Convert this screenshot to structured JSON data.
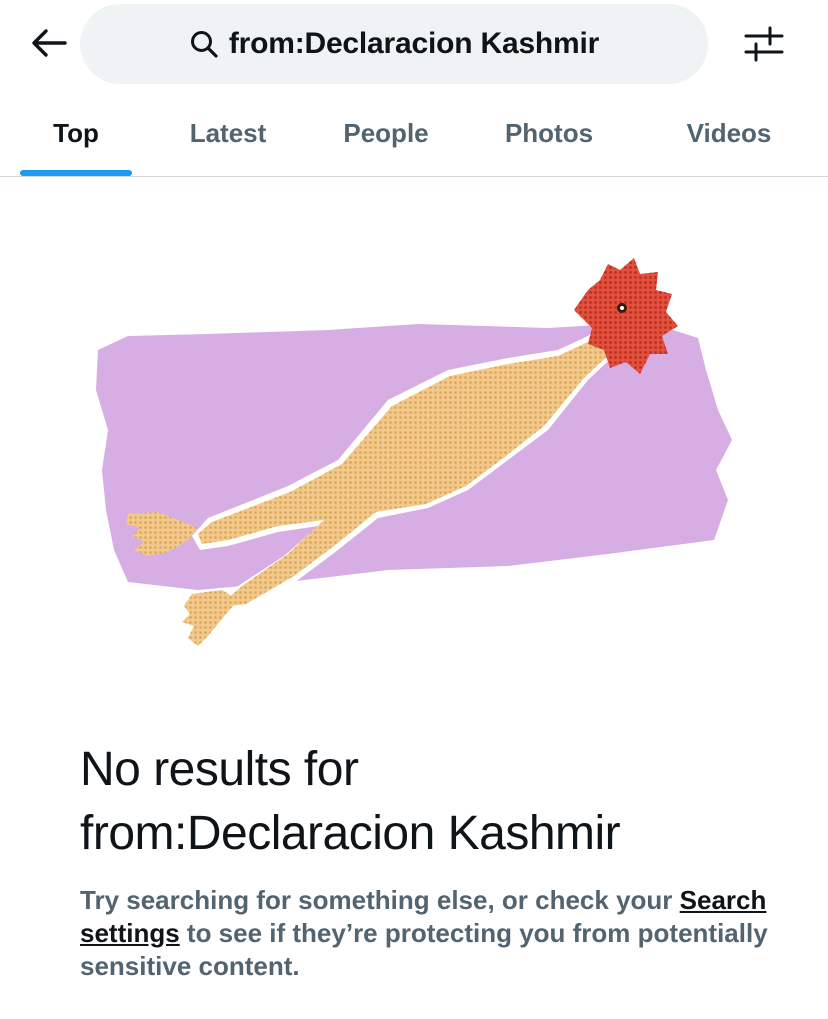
{
  "header": {
    "back_icon": "arrow-left-icon",
    "search_icon": "search-icon",
    "search_query": "from:Declaracion Kashmir",
    "filter_icon": "sliders-icon"
  },
  "tabs": [
    {
      "label": "Top",
      "active": true
    },
    {
      "label": "Latest",
      "active": false
    },
    {
      "label": "People",
      "active": false
    },
    {
      "label": "Photos",
      "active": false
    },
    {
      "label": "Videos",
      "active": false
    }
  ],
  "colors": {
    "accent": "#1d9bf0",
    "muted_text": "#536471",
    "search_bg": "#eff3f4",
    "illustration_bg": "#d7aee3"
  },
  "empty_state": {
    "illustration": "rubber-chicken-illustration",
    "title_line1": "No results for",
    "title_line2": "from:Declaracion Kashmir",
    "body_prefix": "Try searching for something else, or check your",
    "link_text": "Search settings",
    "body_suffix": " to see if they’re protecting you from potentially sensitive content."
  }
}
